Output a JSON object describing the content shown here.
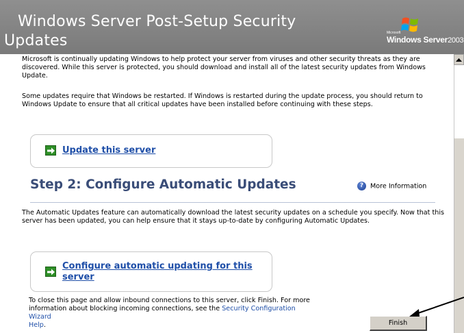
{
  "header": {
    "title_line1": "Windows Server Post-Setup Security",
    "title_line2": "Updates",
    "logo": {
      "microsoft_label": "Microsoft",
      "product_name": "Windows Server",
      "product_year": "2003"
    }
  },
  "intro": {
    "paragraph1": "Microsoft is continually updating Windows to help protect your server from viruses and other security threats as they are discovered. While this server is protected, you should download and install all of the latest security updates from Windows Update.",
    "paragraph2": "Some updates require that Windows be restarted. If Windows is restarted during the update process, you should return to Windows Update to ensure that all critical updates have been installed before continuing with these steps."
  },
  "update_action": {
    "label": "Update this server",
    "icon": "green-arrow-icon"
  },
  "step2": {
    "title": "Step 2: Configure Automatic Updates",
    "more_info": "More Information",
    "more_info_icon": "help-icon",
    "description": "The Automatic Updates feature can automatically download the latest security updates on a schedule you specify. Now that this server has been updated, you can help ensure that it stays up-to-date by configuring Automatic Updates.",
    "action_line1": "Configure automatic updating for this",
    "action_line2": "server"
  },
  "footer": {
    "text_before_link": "To close this page and allow inbound connections to this server, click Finish. For more information about blocking incoming connections, see the ",
    "link_text": "Security Configuration Wizard",
    "link_text2": "Help",
    "text_after_link": ".",
    "finish_label": "Finish"
  },
  "colors": {
    "header_bg": "#888888",
    "link": "#1f4fa8",
    "step_title": "#3a4d78",
    "action_icon": "#2e8f27"
  }
}
